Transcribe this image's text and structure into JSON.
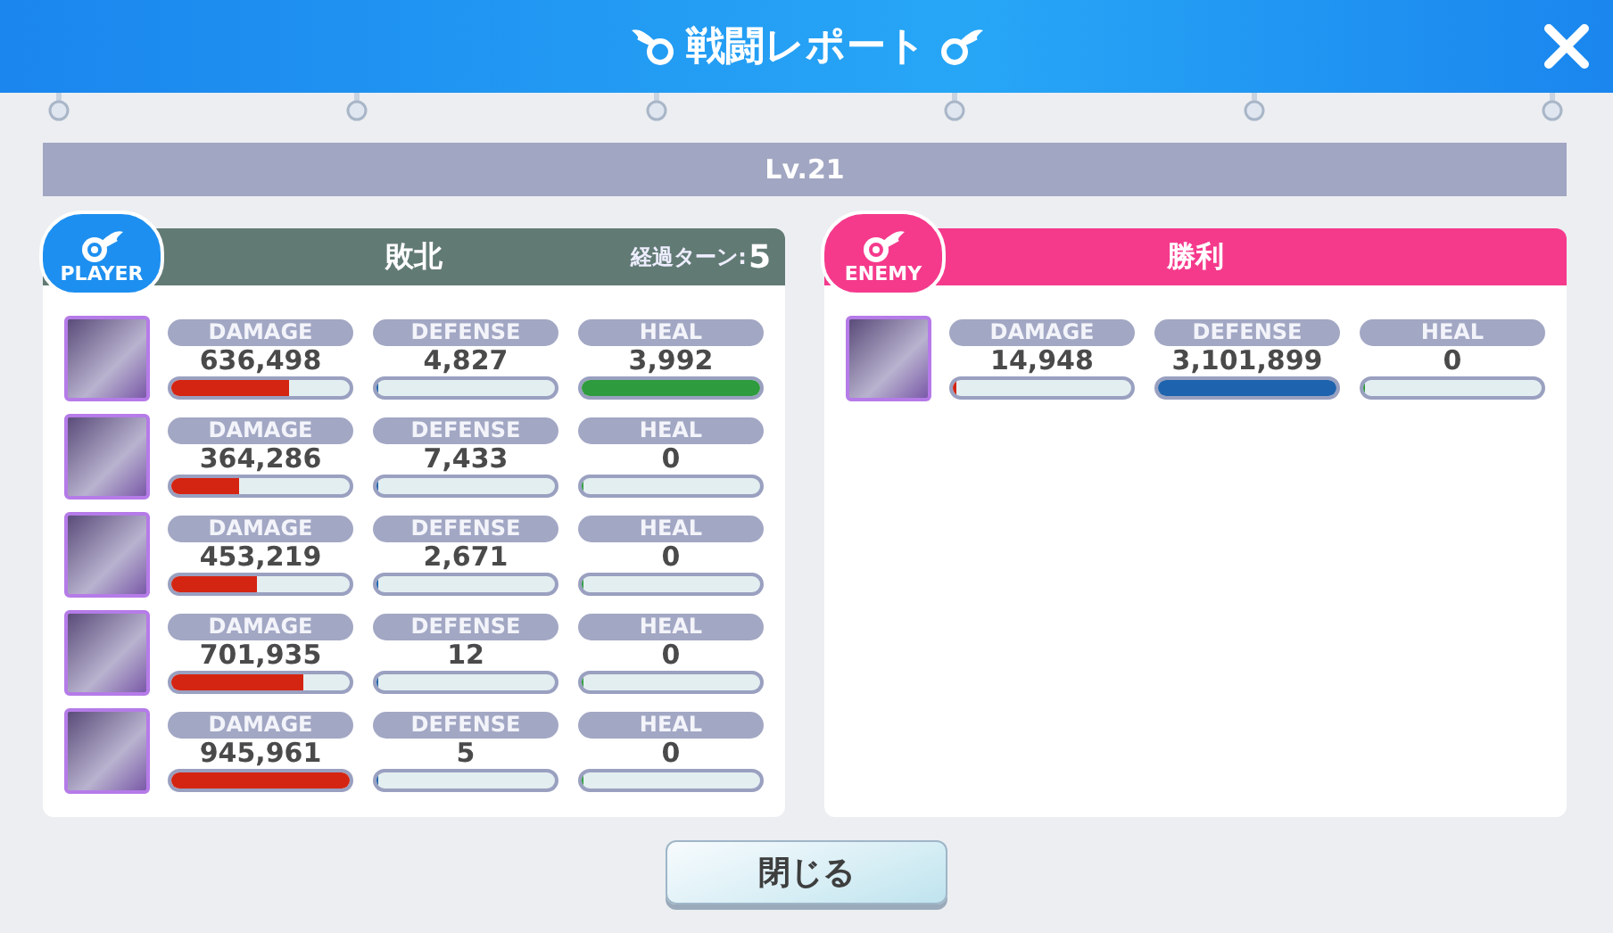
{
  "header": {
    "title": "戦闘レポート"
  },
  "level_label": "Lv.21",
  "teams": [
    {
      "kind": "player",
      "badge": "PLAYER",
      "color": "#1d8ff0",
      "result": "敗北",
      "turns_label": "経過ターン:",
      "turns": "5",
      "members": [
        {
          "stats": [
            {
              "label": "DAMAGE",
              "value": "636,498",
              "level": 0.66
            },
            {
              "label": "DEFENSE",
              "value": "4,827",
              "level": 0
            },
            {
              "label": "HEAL",
              "value": "3,992",
              "level": 1
            }
          ]
        },
        {
          "stats": [
            {
              "label": "DAMAGE",
              "value": "364,286",
              "level": 0.38
            },
            {
              "label": "DEFENSE",
              "value": "7,433",
              "level": 0
            },
            {
              "label": "HEAL",
              "value": "0",
              "level": 0
            }
          ]
        },
        {
          "stats": [
            {
              "label": "DAMAGE",
              "value": "453,219",
              "level": 0.48
            },
            {
              "label": "DEFENSE",
              "value": "2,671",
              "level": 0
            },
            {
              "label": "HEAL",
              "value": "0",
              "level": 0
            }
          ]
        },
        {
          "stats": [
            {
              "label": "DAMAGE",
              "value": "701,935",
              "level": 0.74
            },
            {
              "label": "DEFENSE",
              "value": "12",
              "level": 0
            },
            {
              "label": "HEAL",
              "value": "0",
              "level": 0
            }
          ]
        },
        {
          "stats": [
            {
              "label": "DAMAGE",
              "value": "945,961",
              "level": 1
            },
            {
              "label": "DEFENSE",
              "value": "5",
              "level": 0
            },
            {
              "label": "HEAL",
              "value": "0",
              "level": 0
            }
          ]
        }
      ]
    },
    {
      "kind": "enemy",
      "badge": "ENEMY",
      "color": "#f53a8c",
      "result": "勝利",
      "members": [
        {
          "stats": [
            {
              "label": "DAMAGE",
              "value": "14,948",
              "level": 0.02
            },
            {
              "label": "DEFENSE",
              "value": "3,101,899",
              "level": 1
            },
            {
              "label": "HEAL",
              "value": "0",
              "level": 0
            }
          ]
        }
      ]
    }
  ],
  "close_button": "閉じる"
}
